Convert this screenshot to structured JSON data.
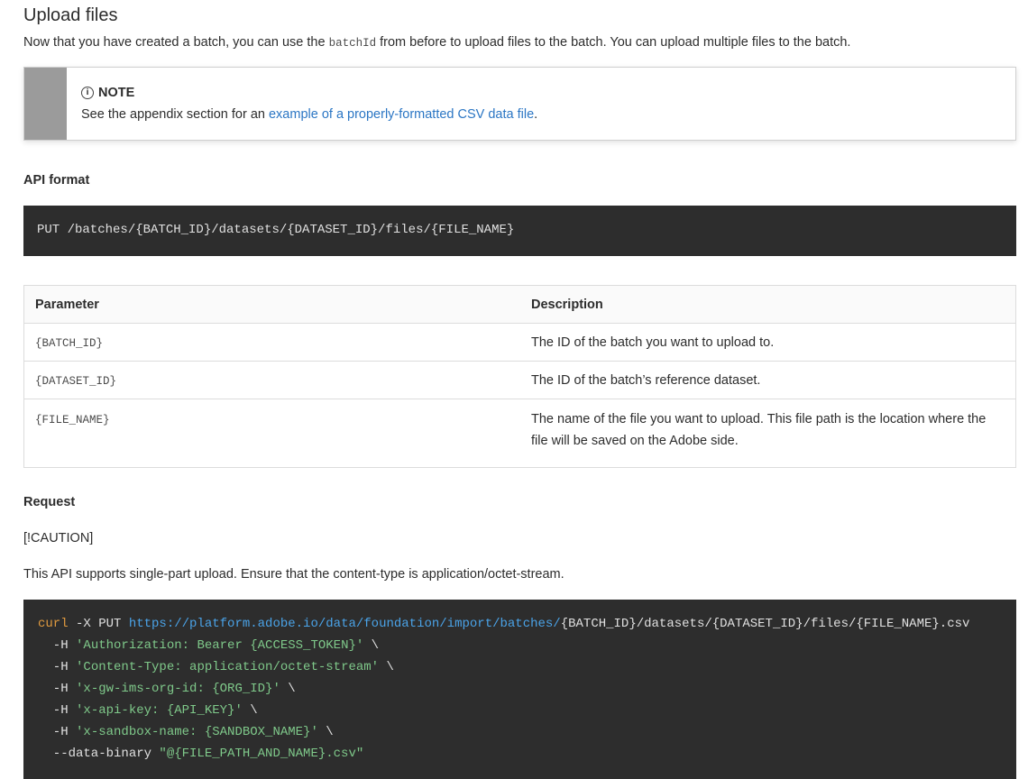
{
  "section": {
    "title": "Upload files",
    "intro_before": "Now that you have created a batch, you can use the ",
    "intro_code": "batchId",
    "intro_after": " from before to upload files to the batch. You can upload multiple files to the batch."
  },
  "note": {
    "icon": "info-icon",
    "title": "NOTE",
    "text_before": "See the appendix section for an ",
    "link_text": "example of a properly-formatted CSV data file",
    "text_after": "."
  },
  "api_format": {
    "heading": "API format",
    "code": "PUT /batches/{BATCH_ID}/datasets/{DATASET_ID}/files/{FILE_NAME}"
  },
  "params_table": {
    "headers": [
      "Parameter",
      "Description"
    ],
    "rows": [
      {
        "param": "{BATCH_ID}",
        "desc": "The ID of the batch you want to upload to."
      },
      {
        "param": "{DATASET_ID}",
        "desc": "The ID of the batch’s reference dataset."
      },
      {
        "param": "{FILE_NAME}",
        "desc_line1": "The name of the file you want to upload. This file path is the location where the",
        "desc_line2": "file will be saved on the Adobe side."
      }
    ]
  },
  "request": {
    "heading": "Request",
    "caution": "[!CAUTION]",
    "text": "This API supports single-part upload. Ensure that the content-type is application/octet-stream."
  },
  "curl": {
    "cmd": "curl",
    "l1_a": " -X PUT ",
    "l1_url": "https://platform.adobe.io/data/foundation/import/batches/",
    "l1_b": "{BATCH_ID}/datasets/{DATASET_ID}/files/{FILE_NAME}.csv",
    "l2_a": "  -H ",
    "l2_s": "'Authorization: Bearer {ACCESS_TOKEN}'",
    "l2_b": " \\",
    "l3_a": "  -H ",
    "l3_s": "'Content-Type: application/octet-stream'",
    "l3_b": " \\",
    "l4_a": "  -H ",
    "l4_s": "'x-gw-ims-org-id: {ORG_ID}'",
    "l4_b": " \\",
    "l5_a": "  -H ",
    "l5_s": "'x-api-key: {API_KEY}'",
    "l5_b": " \\",
    "l6_a": "  -H ",
    "l6_s": "'x-sandbox-name: {SANDBOX_NAME}'",
    "l6_b": " \\",
    "l7_a": "  --data-binary ",
    "l7_s": "\"@{FILE_PATH_AND_NAME}.csv\""
  }
}
